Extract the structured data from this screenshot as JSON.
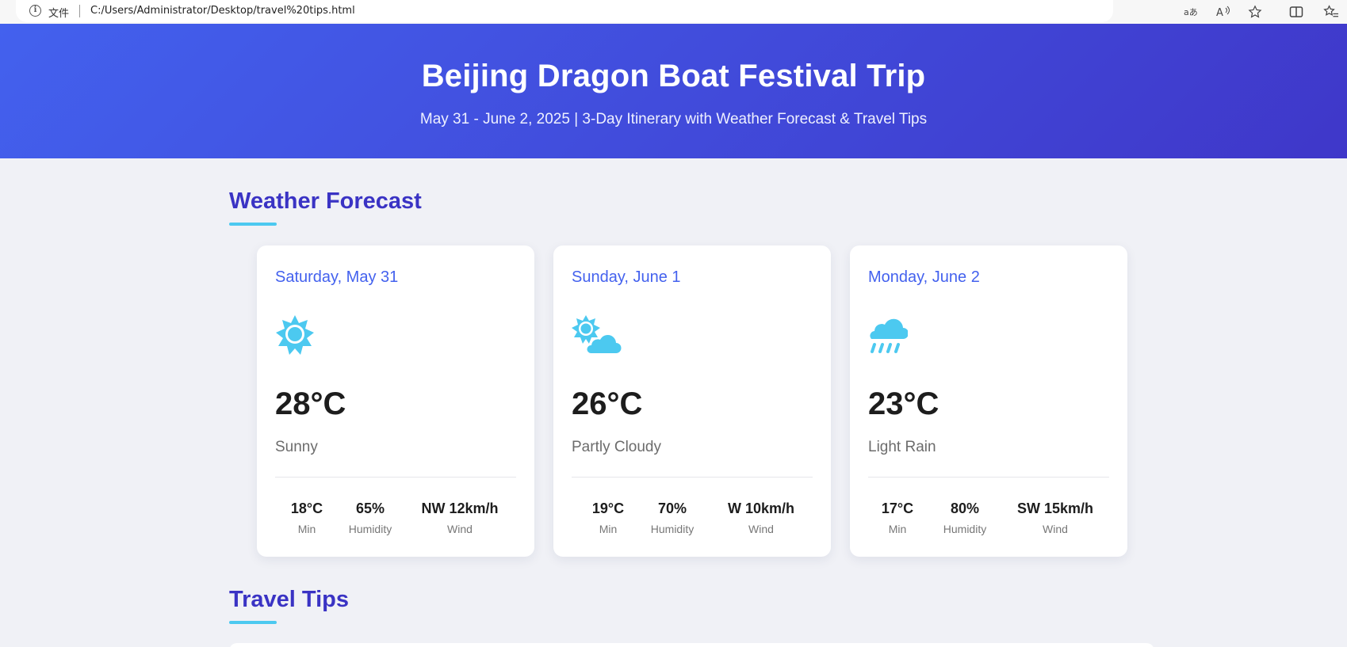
{
  "browser": {
    "file_label": "文件",
    "url": "C:/Users/Administrator/Desktop/travel%20tips.html",
    "icons": [
      "info-icon",
      "read-aloud-icon",
      "text-size-icon",
      "favorite-star-icon",
      "split-screen-icon",
      "favorites-list-icon"
    ]
  },
  "hero": {
    "title": "Beijing Dragon Boat Festival Trip",
    "subtitle": "May 31 - June 2, 2025 | 3-Day Itinerary with Weather Forecast & Travel Tips",
    "gradient_start": "#4361ee",
    "gradient_end": "#3f37c9"
  },
  "weather": {
    "title": "Weather Forecast",
    "days": [
      {
        "date": "Saturday, May 31",
        "icon": "sun-icon",
        "temp": "28°C",
        "condition": "Sunny",
        "min": "18°C",
        "min_label": "Min",
        "humidity": "65%",
        "humidity_label": "Humidity",
        "wind": "NW 12km/h",
        "wind_label": "Wind"
      },
      {
        "date": "Sunday, June 1",
        "icon": "partly-cloudy-icon",
        "temp": "26°C",
        "condition": "Partly Cloudy",
        "min": "19°C",
        "min_label": "Min",
        "humidity": "70%",
        "humidity_label": "Humidity",
        "wind": "W 10km/h",
        "wind_label": "Wind"
      },
      {
        "date": "Monday, June 2",
        "icon": "rain-cloud-icon",
        "temp": "23°C",
        "condition": "Light Rain",
        "min": "17°C",
        "min_label": "Min",
        "humidity": "80%",
        "humidity_label": "Humidity",
        "wind": "SW 15km/h",
        "wind_label": "Wind"
      }
    ]
  },
  "tips": {
    "title": "Travel Tips"
  },
  "colors": {
    "accent": "#4361ee",
    "heading": "#3a33c4",
    "underline": "#4cc9f0",
    "icon": "#4cc9f0"
  }
}
